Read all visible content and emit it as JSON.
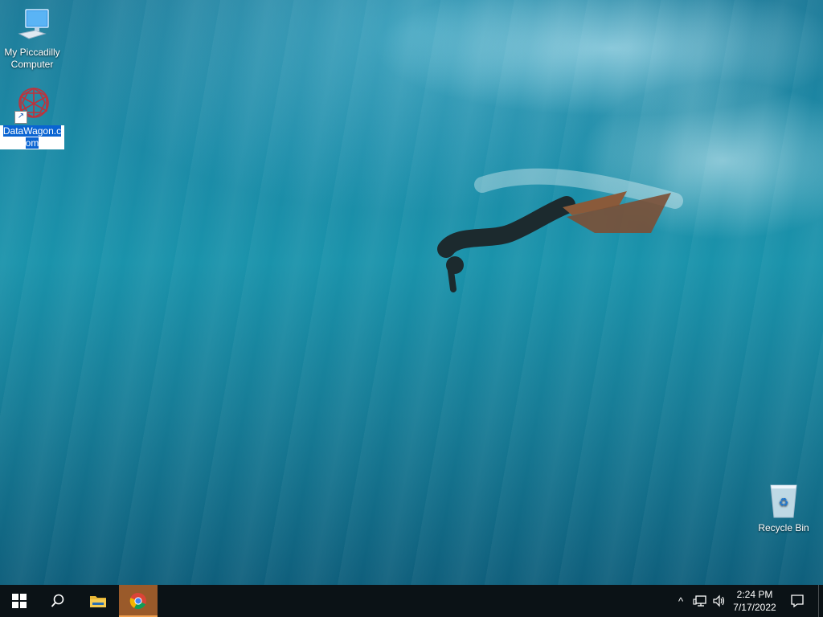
{
  "desktop": {
    "icons": [
      {
        "label": "My Piccadilly Computer",
        "icon": "computer-icon"
      },
      {
        "label_part1": "DataWagon.c",
        "label_part2": "om",
        "icon": "datawagon-shortcut-icon",
        "selected": true
      },
      {
        "label": "Recycle Bin",
        "icon": "recycle-bin-icon"
      }
    ]
  },
  "taskbar": {
    "buttons": [
      {
        "name": "start-button",
        "icon": "windows-logo-icon"
      },
      {
        "name": "search-button",
        "icon": "search-icon"
      },
      {
        "name": "file-explorer-button",
        "icon": "folder-icon"
      },
      {
        "name": "chrome-button",
        "icon": "chrome-icon",
        "active": true
      }
    ],
    "tray": {
      "chevron": "^",
      "time": "2:24 PM",
      "date": "7/17/2022"
    }
  },
  "colors": {
    "taskbar_bg": "#0b1216",
    "active_app_bg": "#9a5a2a",
    "selection_blue": "#0a64d2"
  }
}
